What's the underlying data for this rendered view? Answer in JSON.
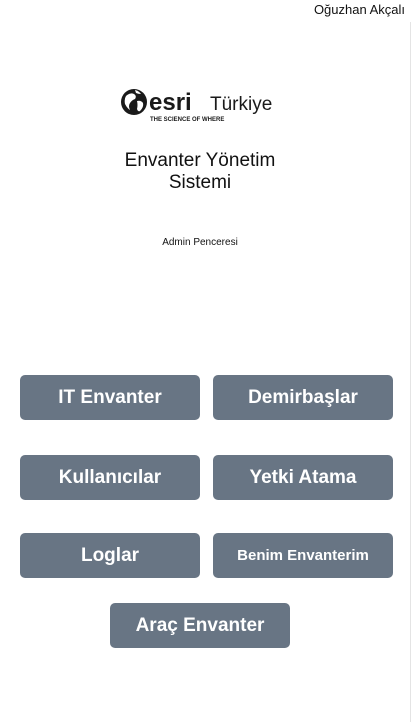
{
  "header": {
    "user_name": "Oğuzhan Akçalı"
  },
  "logo": {
    "brand": "esri",
    "region": "Türkiye",
    "tagline": "THE SCIENCE OF WHERE"
  },
  "app": {
    "title_line1": "Envanter Yönetim",
    "title_line2": "Sistemi",
    "subtitle": "Admin Penceresi"
  },
  "menu": {
    "it_envanter": "IT Envanter",
    "demirbaslar": "Demirbaşlar",
    "kullanicilar": "Kullanıcılar",
    "yetki_atama": "Yetki Atama",
    "loglar": "Loglar",
    "benim_envanterim": "Benim Envanterim",
    "arac_envanter": "Araç Envanter"
  },
  "colors": {
    "button_bg": "#687584",
    "button_text": "#ffffff",
    "background": "#ffffff"
  }
}
